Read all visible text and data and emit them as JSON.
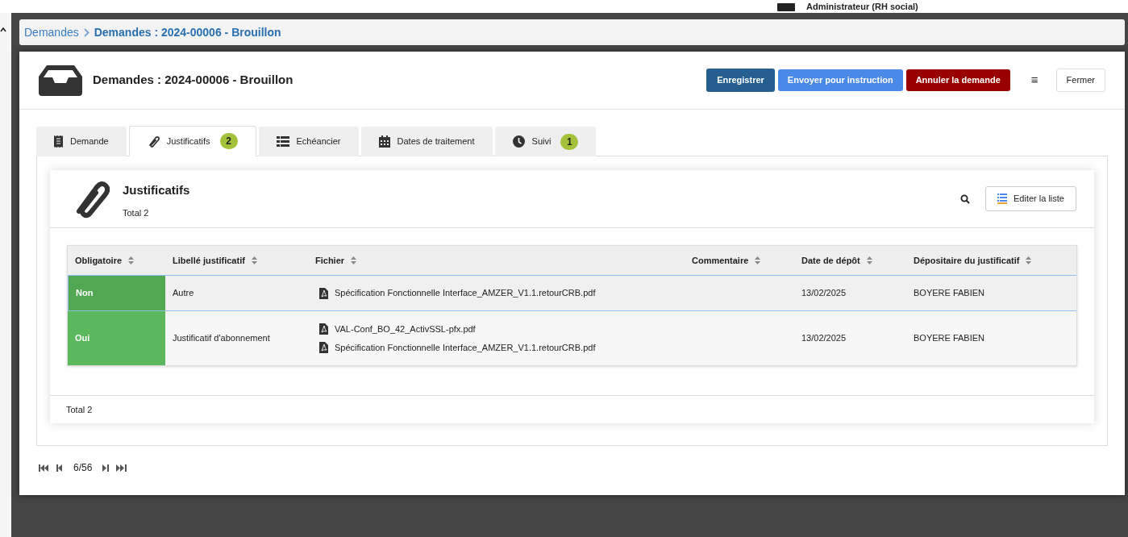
{
  "user": {
    "name": "Administrateur (RH social)"
  },
  "breadcrumb": [
    {
      "label": "Demandes",
      "current": false
    },
    {
      "label": "Demandes : 2024-00006 - Brouillon",
      "current": true
    }
  ],
  "header": {
    "title": "Demandes : 2024-00006 - Brouillon"
  },
  "actions": [
    {
      "label": "Enregistrer",
      "kind": "primary"
    },
    {
      "label": "Envoyer pour instruction",
      "kind": "info"
    },
    {
      "label": "Annuler la demande",
      "kind": "danger"
    },
    {
      "label": "≡",
      "kind": "menu"
    },
    {
      "label": "Fermer",
      "kind": "default"
    }
  ],
  "tabs": [
    {
      "label": "Demande",
      "selected": false
    },
    {
      "label": "Justificatifs",
      "badge": "2",
      "selected": true
    },
    {
      "label": "Echéancier",
      "selected": false
    },
    {
      "label": "Dates de traitement",
      "selected": false
    },
    {
      "label": "Suivi",
      "badge": "1",
      "selected": false
    }
  ],
  "panel": {
    "title": "Justificatifs",
    "subtitle": "Total 2",
    "edit_button": "Editer la liste",
    "footer": "Total 2"
  },
  "table": {
    "columns": [
      "Obligatoire",
      "Libellé justificatif",
      "Fichier",
      "Commentaire",
      "Date de dépôt",
      "Dépositaire du justificatif"
    ],
    "rows": [
      {
        "obligatoire": "Non",
        "libelle": "Autre",
        "files": [
          "Spécification Fonctionnelle Interface_AMZER_V1.1.retourCRB.pdf"
        ],
        "date": "13/02/2025",
        "depositaire": "BOYERE FABIEN",
        "selected": true
      },
      {
        "obligatoire": "Oui",
        "libelle": "Justificatif d'abonnement",
        "files": [
          "VAL-Conf_BO_42_ActivSSL-pfx.pdf",
          "Spécification Fonctionnelle Interface_AMZER_V1.1.retourCRB.pdf"
        ],
        "date": "13/02/2025",
        "depositaire": "BOYERE FABIEN",
        "selected": false
      }
    ]
  },
  "pager": {
    "position": "6/56"
  }
}
